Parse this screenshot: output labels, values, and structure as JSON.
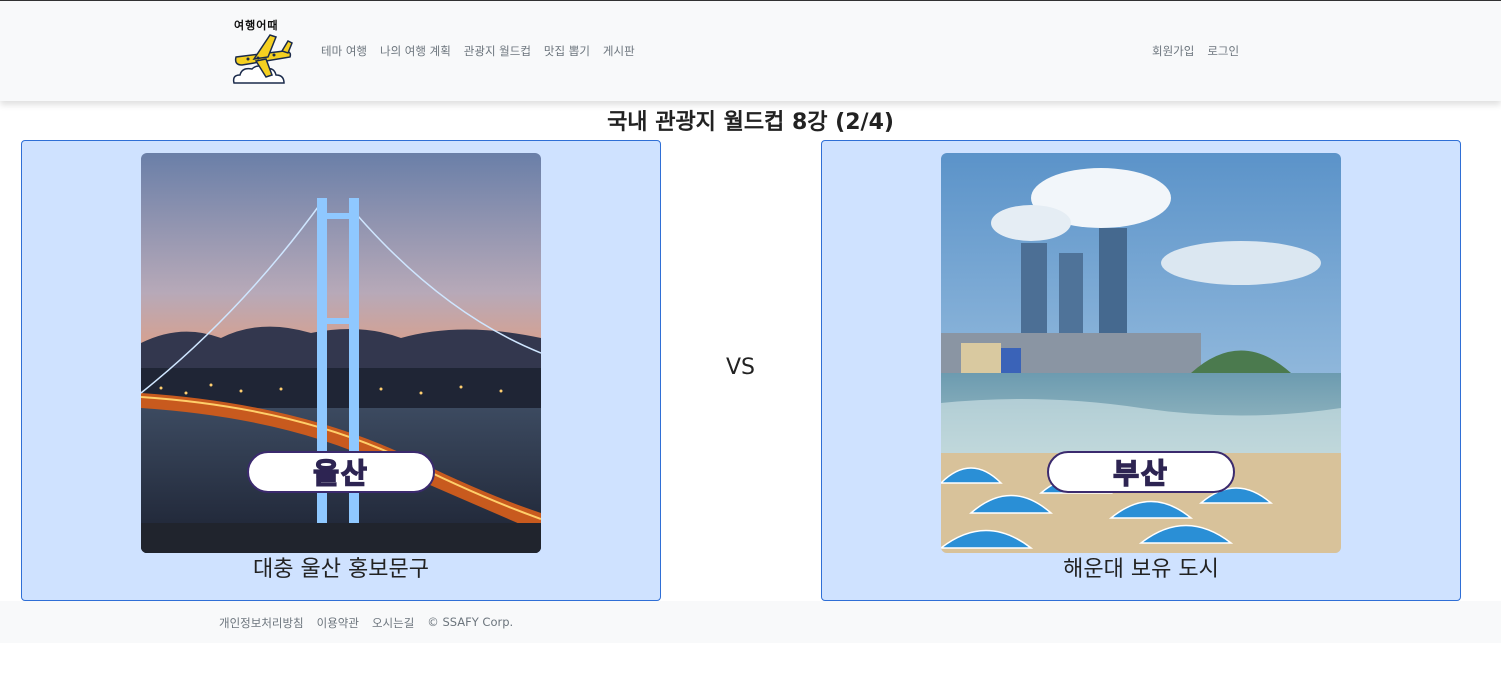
{
  "header": {
    "logo_text": "여행어때",
    "nav": [
      "테마 여행",
      "나의 여행 계획",
      "관광지 월드컵",
      "맛집 뽑기",
      "게시판"
    ],
    "auth": [
      "회원가입",
      "로그인"
    ]
  },
  "main": {
    "title": "국내 관광지 월드컵 8강 (2/4)",
    "vs_label": "VS",
    "left": {
      "badge": "울산",
      "caption": "대충 울산 홍보문구"
    },
    "right": {
      "badge": "부산",
      "caption": "해운대 보유 도시"
    }
  },
  "footer": {
    "links": [
      "개인정보처리방침",
      "이용약관",
      "오시는길",
      "© SSAFY Corp."
    ]
  },
  "colors": {
    "card_bg": "#cfe2ff",
    "card_border": "#2f6fd6",
    "badge_text": "#d8ff5a"
  }
}
